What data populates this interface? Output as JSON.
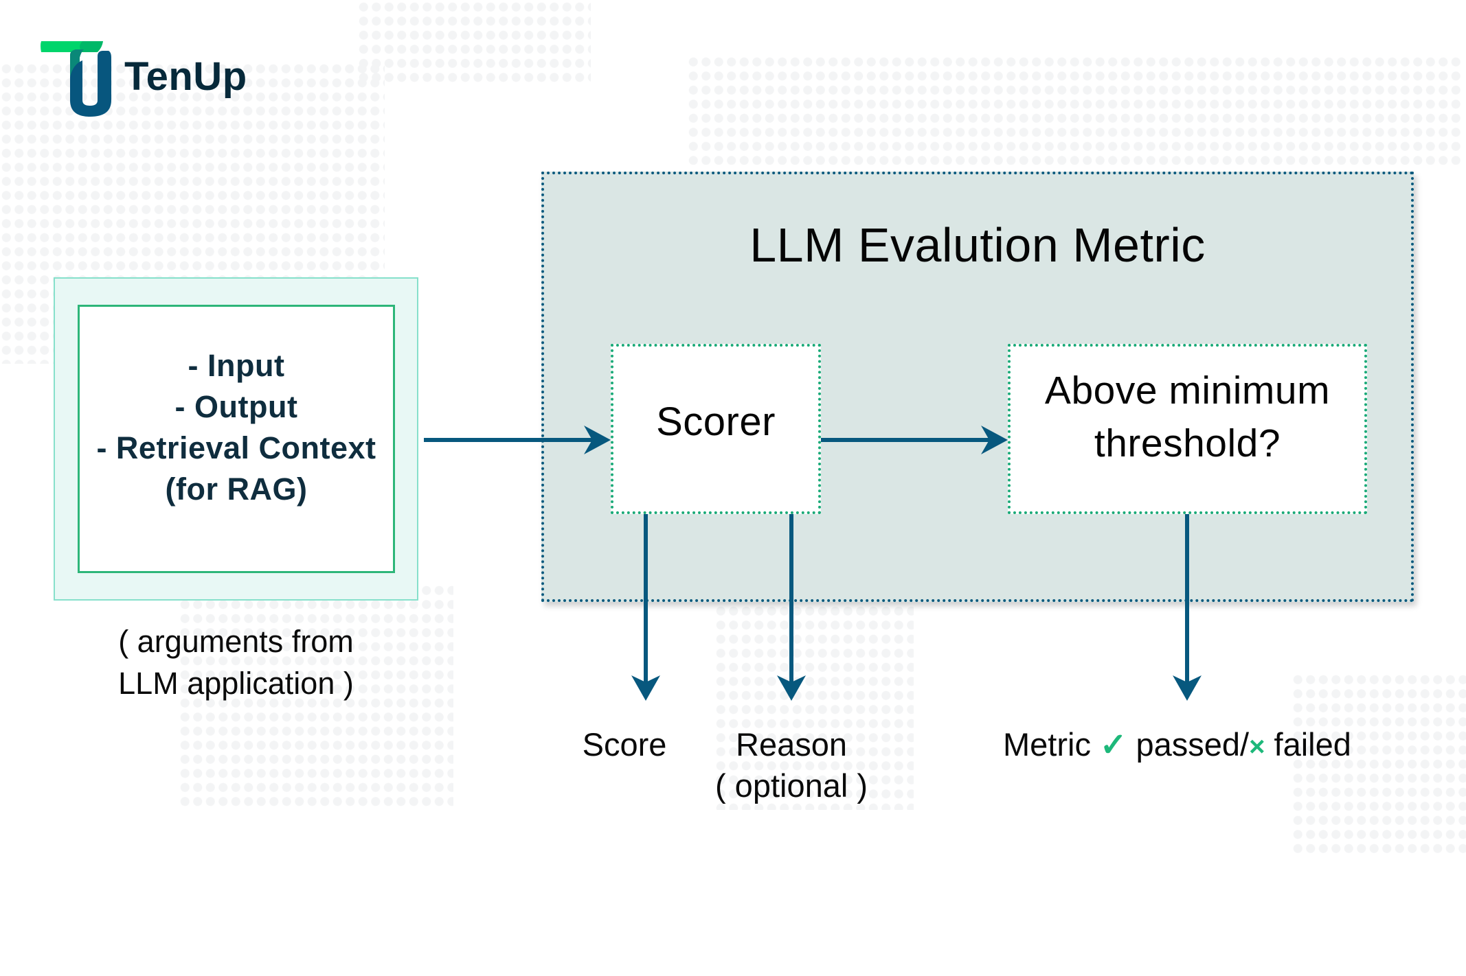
{
  "brand": {
    "name": "TenUp",
    "logo_icon": "tenup-tu-logo-icon",
    "colors": {
      "green": "#00d56b",
      "teal": "#0a8878",
      "navy": "#07567e",
      "text": "#06293a"
    }
  },
  "input_box": {
    "items": [
      "- Input",
      "- Output",
      "- Retrieval Context",
      "(for RAG)"
    ],
    "caption_lines": [
      "( arguments from",
      "LLM application )"
    ]
  },
  "metric": {
    "title": "LLM Evalution Metric",
    "scorer_label": "Scorer",
    "threshold_lines": [
      "Above minimum",
      "threshold?"
    ]
  },
  "outputs": {
    "score": "Score",
    "reason": "Reason",
    "reason_note": "( optional )",
    "result_prefix": "Metric",
    "check_icon": "✓",
    "passed": "passed/",
    "cross_icon": "×",
    "failed": "failed"
  },
  "colors": {
    "arrow": "#07587e",
    "container_fill": "#dae6e4",
    "container_border": "#0b5a7e",
    "inner_border": "#1aaa78",
    "input_fill": "#e8f8f5",
    "input_inner_border": "#2db679",
    "status_green": "#1db87a"
  }
}
